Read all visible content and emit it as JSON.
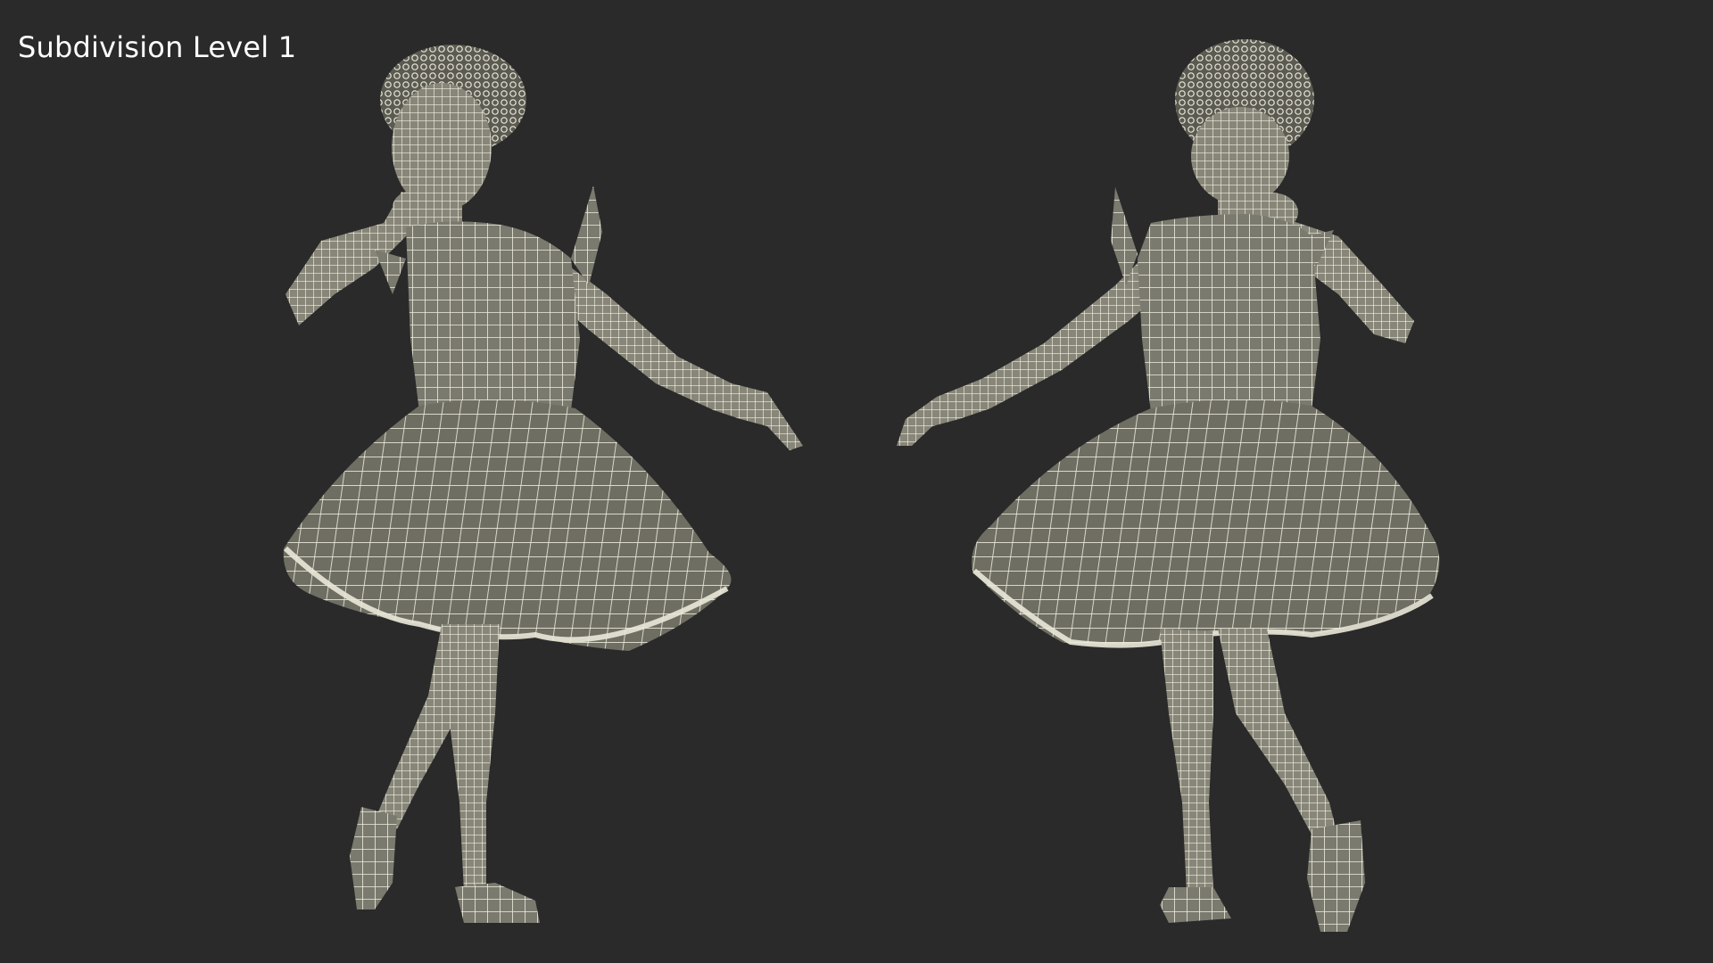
{
  "overlay": {
    "caption": "Subdivision Level 1"
  },
  "render": {
    "background_color": "#2a2a2a",
    "mesh_fill_color": "#7a7a6e",
    "wire_color": "#f2f1e4",
    "figures": [
      {
        "view": "front",
        "subject": "girl in dress, wireframe"
      },
      {
        "view": "back",
        "subject": "girl in dress, wireframe"
      }
    ]
  }
}
